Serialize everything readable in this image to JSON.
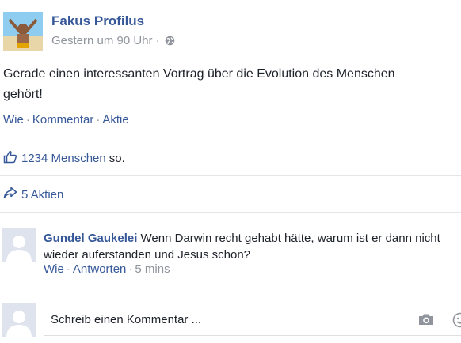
{
  "post": {
    "author": "Fakus Profilus",
    "timestamp": "Gestern um 90 Uhr",
    "meta_separator": "·",
    "text_line1": "Gerade einen interessanten Vortrag über die Evolution des Menschen",
    "text_line2": "gehört!",
    "actions": {
      "like": "Wie",
      "comment": "Kommentar",
      "share": "Aktie",
      "separator": "·"
    }
  },
  "likes": {
    "count_label": "1234 Menschen",
    "suffix": "so."
  },
  "shares": {
    "label": "5 Aktien"
  },
  "comment": {
    "author": "Gundel Gaukelei",
    "text_line1": "Wenn Darwin recht gehabt hätte, warum ist er dann nicht",
    "text_line2": "wieder auferstanden und Jesus schon?",
    "actions": {
      "like": "Wie",
      "reply": "Antworten",
      "time": "5 mins",
      "separator": "·"
    }
  },
  "composer": {
    "placeholder": "Schreib einen Kommentar ..."
  },
  "icons": {
    "globe": "globe-icon",
    "thumbs_up": "thumbs-up-icon",
    "share": "share-arrow-icon",
    "camera": "camera-icon",
    "smiley": "smiley-icon"
  },
  "colors": {
    "link": "#365899",
    "muted": "#90949c",
    "text": "#1d2129",
    "avatar_placeholder": "#dee3ed"
  }
}
